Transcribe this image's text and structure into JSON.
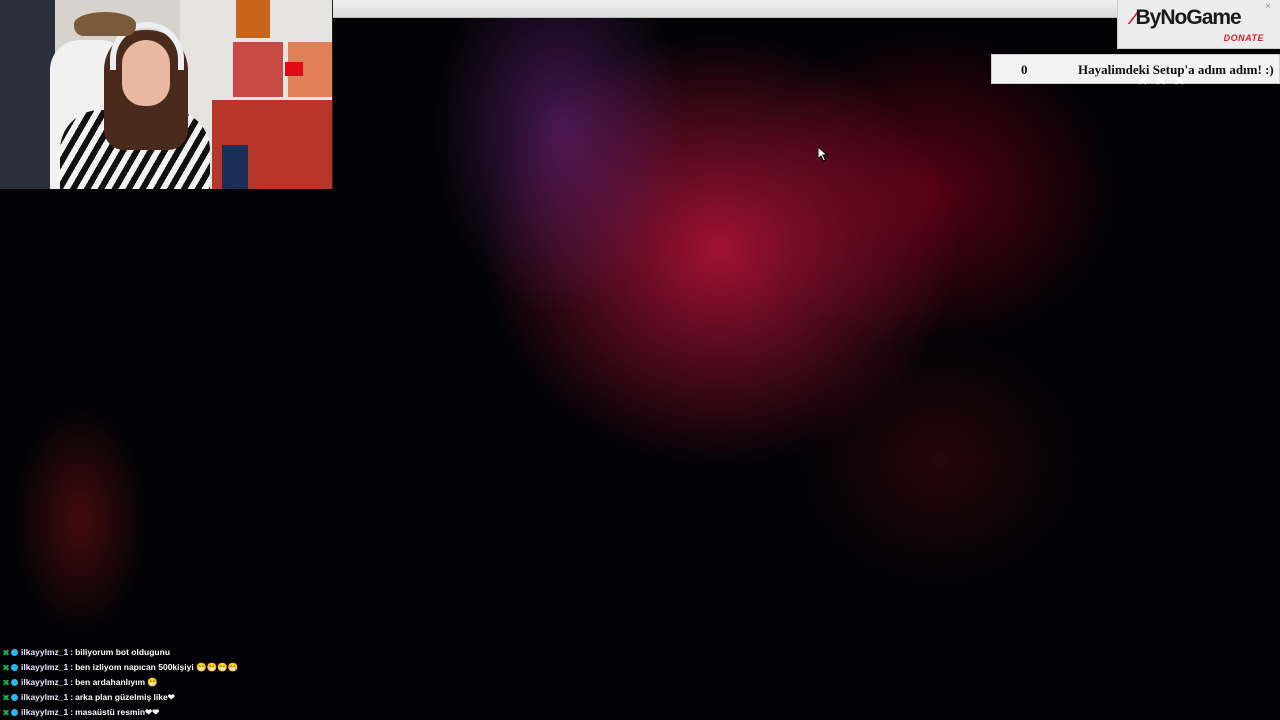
{
  "alert": {
    "brand": "ByNoGame",
    "action": "DONATE",
    "close": "×"
  },
  "goal": {
    "count": "0",
    "title": "Hayalimdeki Setup'a adım adım! :)",
    "stars": "★★★"
  },
  "chat": {
    "messages": [
      {
        "user": "ilkayylmz_1",
        "text": "biliyorum bot oldugunu"
      },
      {
        "user": "ilkayylmz_1",
        "text": "ben izliyom napıcan 500kişiyi 😁😁😁😁"
      },
      {
        "user": "ilkayylmz_1",
        "text": "ben ardahanlıyım 😁"
      },
      {
        "user": "ilkayylmz_1",
        "text": "arka plan güzelmiş like❤"
      },
      {
        "user": "ilkayylmz_1",
        "text": "masaüstü resmin❤❤"
      }
    ]
  },
  "colors": {
    "brand_red": "#d3212f",
    "mod_badge": "#00c853",
    "sub_badge": "#29b6f6"
  }
}
